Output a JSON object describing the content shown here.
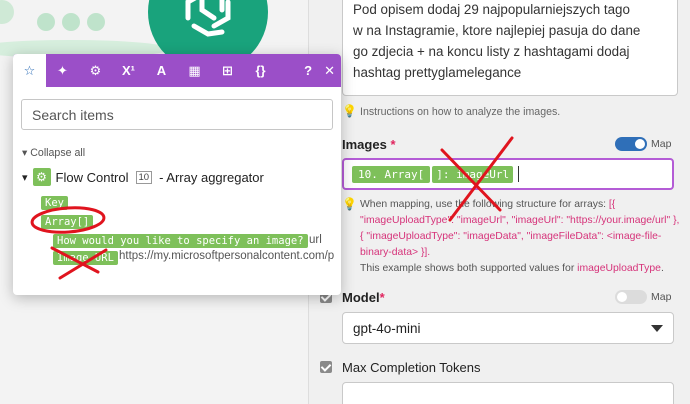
{
  "description_text": "Pod opisem dodaj 29 najpopularniejszych tagów na Instagramie, które najlepiej pasują do dane go zdjęcia + na końcu listy z hashtagami dodaj hashtag prettyglamelegance",
  "description_lines": [
    "Pod opisem dodaj 29 najpopularniejszych tago",
    "w na Instagramie, ktore najlepiej pasuja do dane",
    "go zdjecia + na koncu listy z hashtagami dodaj",
    "hashtag prettyglamelegance"
  ],
  "instructions_hint": "Instructions on how to analyze the images.",
  "images": {
    "label": "Images",
    "required_mark": "*",
    "map_label": "Map",
    "pill_1": "10. Array[",
    "pill_2": "]: imageUrl",
    "help_prefix": "When mapping, use the following structure for arrays:",
    "help_code_1": "[{ \"imageUploadType\": \"imageUrl\", \"imageUrl\": \"https://your.image/url\" }, { \"imageUploadType\": \"imageData\", \"imageFileData\": <image-file-binary-data> }].",
    "help_suffix": "This example shows both supported values for",
    "help_term": "imageUploadType",
    "help_end": "."
  },
  "model": {
    "label": "Model",
    "required_mark": "*",
    "map_label": "Map",
    "value": "gpt-4o-mini"
  },
  "max_tokens": {
    "label": "Max Completion Tokens"
  },
  "popup": {
    "toolbar_icons": [
      "star-icon",
      "sparkle-icon",
      "gear-icon",
      "superscript-icon",
      "text-icon",
      "calendar-icon",
      "table-icon",
      "braces-icon"
    ],
    "toolbar_glyphs": [
      "☆",
      "✦",
      "⚙",
      "X¹",
      "A",
      "▦",
      "⊞",
      "{}"
    ],
    "help_glyph": "?",
    "close_glyph": "✕",
    "search_placeholder": "Search items",
    "collapse_label": "Collapse all",
    "module_name": "Flow Control",
    "module_number": "10",
    "module_suffix": "- Array aggregator",
    "items": {
      "key": "Key",
      "array": "Array[]",
      "question": "How would you like to specify an image?",
      "question_value": "url",
      "image_url": "Image URL",
      "image_url_value": "https://my.microsoftpersonalcontent.com/p"
    }
  }
}
